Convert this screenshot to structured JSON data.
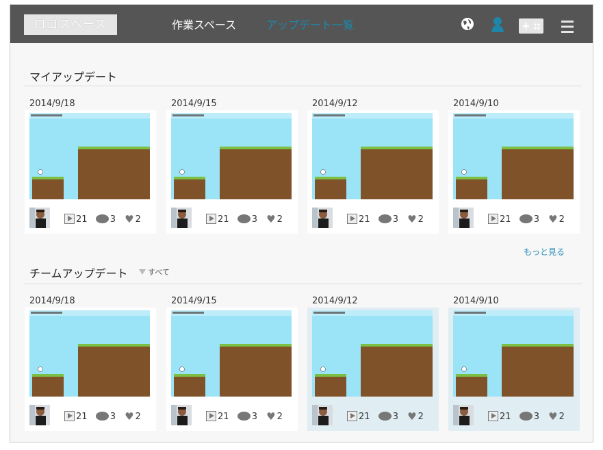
{
  "header": {
    "logo": "ロゴスペース",
    "nav": [
      {
        "label": "作業スペース",
        "active": false
      },
      {
        "label": "アップデート一覧",
        "active": true
      }
    ],
    "icons": [
      "globe-icon",
      "user-icon",
      "gamepad-icon",
      "menu-icon"
    ]
  },
  "my_updates": {
    "title": "マイアップデート",
    "more": "もっと見る",
    "cards": [
      {
        "date": "2014/9/18",
        "plays": "21",
        "comments": "3",
        "likes": "2"
      },
      {
        "date": "2014/9/15",
        "plays": "21",
        "comments": "3",
        "likes": "2"
      },
      {
        "date": "2014/9/12",
        "plays": "21",
        "comments": "3",
        "likes": "2"
      },
      {
        "date": "2014/9/10",
        "plays": "21",
        "comments": "3",
        "likes": "2"
      }
    ]
  },
  "team_updates": {
    "title": "チームアップデート",
    "filter": "すべて",
    "cards": [
      {
        "date": "2014/9/18",
        "plays": "21",
        "comments": "3",
        "likes": "2",
        "highlighted": false
      },
      {
        "date": "2014/9/15",
        "plays": "21",
        "comments": "3",
        "likes": "2",
        "highlighted": false
      },
      {
        "date": "2014/9/12",
        "plays": "21",
        "comments": "3",
        "likes": "2",
        "highlighted": true
      },
      {
        "date": "2014/9/10",
        "plays": "21",
        "comments": "3",
        "likes": "2",
        "highlighted": true
      }
    ]
  },
  "colors": {
    "topbar": "#555555",
    "accent": "#1e86a8",
    "sky": "#9be3f7",
    "dirt": "#8a5a2e",
    "grass": "#7bc043",
    "highlight": "#e0eef4"
  }
}
